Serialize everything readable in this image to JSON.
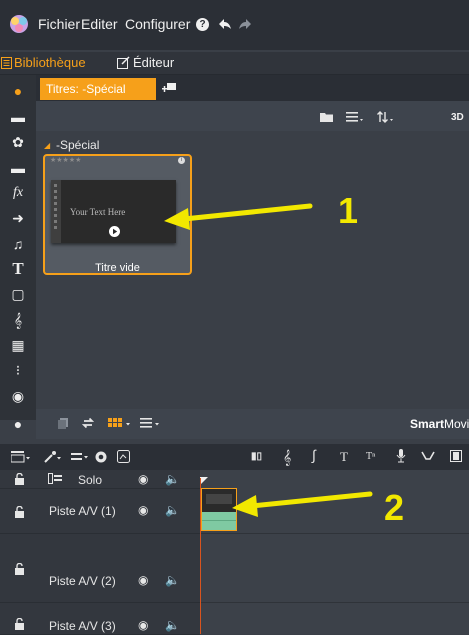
{
  "menu": {
    "items": [
      "Fichier",
      "Editer",
      "Configurer"
    ],
    "help_icon": "help-icon",
    "undo_icon": "undo-icon",
    "redo_icon": "redo-icon"
  },
  "modes": {
    "library_label": "Bibliothèque",
    "editor_label": "Éditeur",
    "active": "library"
  },
  "library": {
    "active_tab": "Titres: -Spécial",
    "section_title": "-Spécial",
    "view_label": "3D",
    "thumbnail": {
      "preview_text": "Your Text Here",
      "caption": "Titre vide",
      "rating_stars": "★★★★★"
    },
    "bottom_brand": {
      "bold": "Smart",
      "regular": "Movie"
    }
  },
  "annotations": {
    "one": "1",
    "two": "2"
  },
  "timeline": {
    "tracks": [
      {
        "label": "Solo"
      },
      {
        "label": "Piste A/V (1)"
      },
      {
        "label": "Piste A/V (2)"
      },
      {
        "label": "Piste A/V (3)"
      }
    ]
  },
  "colors": {
    "accent": "#f6a01a",
    "annotation": "#f2e800",
    "playhead": "#d8541f"
  }
}
